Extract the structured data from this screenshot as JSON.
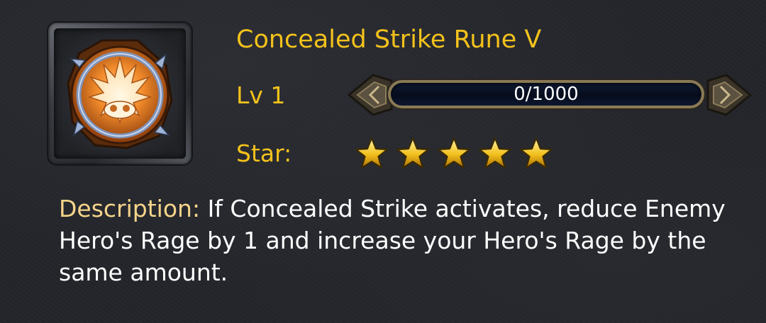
{
  "rune": {
    "title": "Concealed Strike Rune V",
    "icon": "flame-rune-icon",
    "level_label": "Lv 1",
    "progress": {
      "text": "0/1000",
      "current": 0,
      "max": 1000
    },
    "star_label": "Star:",
    "stars": 5,
    "description_label": "Description:",
    "description_text": "If Concealed Strike activates, reduce Enemy Hero's Rage by 1 and increase your Hero's Rage by the same amount."
  },
  "colors": {
    "title_gold": "#f3c21b",
    "description_label": "#f6d48a",
    "background": "#23252a",
    "rune_orange": "#e07a1e"
  }
}
